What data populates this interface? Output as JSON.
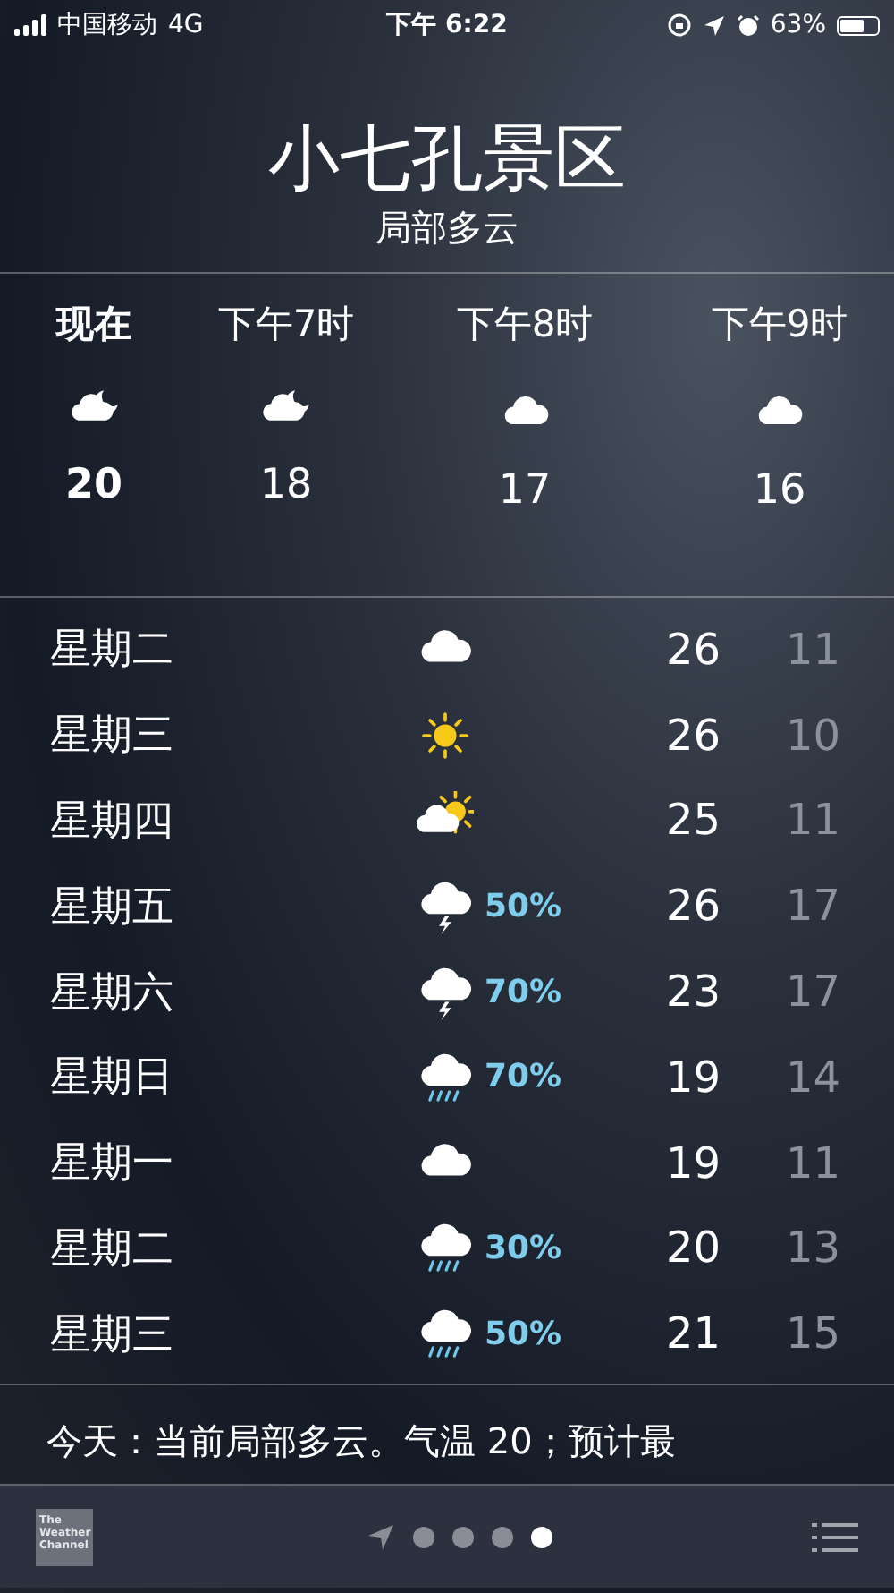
{
  "status_bar": {
    "carrier": "中国移动",
    "network": "4G",
    "time": "下午 6:22",
    "battery": "63%"
  },
  "location": {
    "name": "小七孔景区",
    "condition": "局部多云"
  },
  "hourly": [
    {
      "time": "现在",
      "kind": "cloud-moon",
      "temp": "20",
      "now": true
    },
    {
      "time": "下午7时",
      "kind": "cloud-moon",
      "temp": "18",
      "now": false
    },
    {
      "time": "下午8时",
      "kind": "cloud",
      "temp": "17",
      "now": false
    },
    {
      "time": "下午9时",
      "kind": "cloud",
      "temp": "16",
      "now": false
    }
  ],
  "daily": [
    {
      "day": "星期二",
      "kind": "cloud",
      "high": "26",
      "low": "11"
    },
    {
      "day": "星期三",
      "kind": "sun",
      "high": "26",
      "low": "10"
    },
    {
      "day": "星期四",
      "kind": "partly-sunny",
      "high": "25",
      "low": "11"
    },
    {
      "day": "星期五",
      "kind": "thunder",
      "precip": "50%",
      "high": "26",
      "low": "17"
    },
    {
      "day": "星期六",
      "kind": "thunder",
      "precip": "70%",
      "high": "23",
      "low": "17"
    },
    {
      "day": "星期日",
      "kind": "rain",
      "precip": "70%",
      "high": "19",
      "low": "14"
    },
    {
      "day": "星期一",
      "kind": "cloud",
      "high": "19",
      "low": "11"
    },
    {
      "day": "星期二",
      "kind": "rain",
      "precip": "30%",
      "high": "20",
      "low": "13"
    },
    {
      "day": "星期三",
      "kind": "rain",
      "precip": "50%",
      "high": "21",
      "low": "15"
    }
  ],
  "summary": "今天：当前局部多云。气温 20；预计最",
  "footer": {
    "logo": "The Weather Channel",
    "pages": [
      {
        "selected": false
      },
      {
        "selected": false
      },
      {
        "selected": false
      },
      {
        "selected": true
      }
    ]
  }
}
